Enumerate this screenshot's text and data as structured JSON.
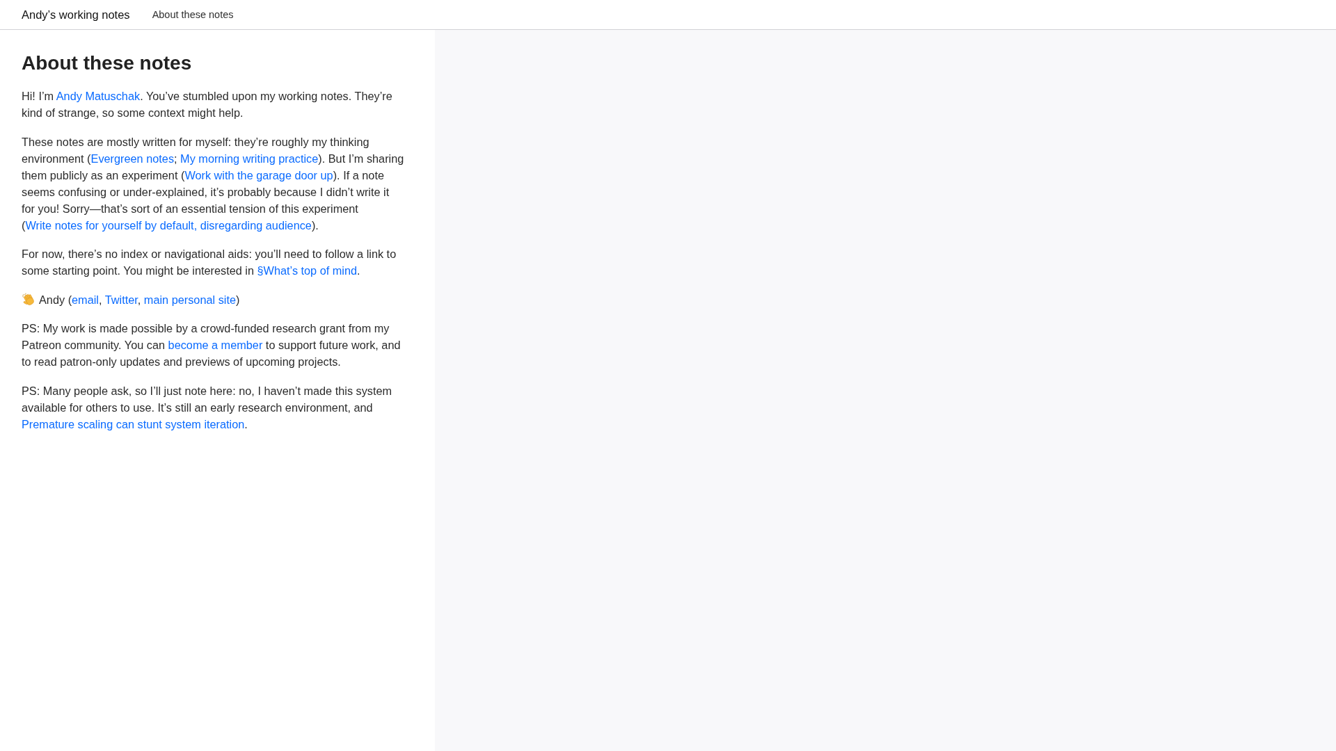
{
  "top_bar": {
    "site_title": "Andy’s working notes",
    "breadcrumbs": [
      {
        "label": "About these notes"
      }
    ]
  },
  "note": {
    "title": "About these notes",
    "paragraphs": [
      {
        "kind": "body",
        "parts": [
          {
            "kind": "text",
            "text": "Hi! I’m "
          },
          {
            "kind": "link",
            "text": "Andy Matuschak"
          },
          {
            "kind": "text",
            "text": ". You’ve stumbled upon my working notes. They’re kind of strange, so some context might help."
          }
        ]
      },
      {
        "kind": "body",
        "parts": [
          {
            "kind": "text",
            "text": "These notes are mostly written for myself: they’re roughly my thinking environment ("
          },
          {
            "kind": "link",
            "text": "Evergreen notes"
          },
          {
            "kind": "text",
            "text": "; "
          },
          {
            "kind": "link",
            "text": "My morning writing practice"
          },
          {
            "kind": "text",
            "text": "). But I’m sharing them publicly as an experiment ("
          },
          {
            "kind": "link",
            "text": "Work with the garage door up"
          },
          {
            "kind": "text",
            "text": "). If a note seems confusing or under-explained, it’s probably because I didn’t write it for you! Sorry—that’s sort of an essential tension of this experiment ("
          },
          {
            "kind": "link",
            "text": "Write notes for yourself by default, disregarding audience"
          },
          {
            "kind": "text",
            "text": ")."
          }
        ]
      },
      {
        "kind": "body",
        "parts": [
          {
            "kind": "text",
            "text": "For now, there’s no index or navigational aids: you’ll need to follow a link to some starting point. You might be interested in "
          },
          {
            "kind": "link",
            "text": "§What’s top of mind"
          },
          {
            "kind": "text",
            "text": "."
          }
        ]
      },
      {
        "kind": "sign_off",
        "parts": [
          {
            "kind": "text",
            "text": "Andy ("
          },
          {
            "kind": "link",
            "text": "email"
          },
          {
            "kind": "text",
            "text": ", "
          },
          {
            "kind": "link",
            "text": "Twitter"
          },
          {
            "kind": "text",
            "text": ", "
          },
          {
            "kind": "link",
            "text": "main personal site"
          },
          {
            "kind": "text",
            "text": ")"
          }
        ]
      },
      {
        "kind": "body",
        "parts": [
          {
            "kind": "text",
            "text": "PS: My work is made possible by a crowd-funded research grant from my Patreon community. You can "
          },
          {
            "kind": "link",
            "text": "become a member"
          },
          {
            "kind": "text",
            "text": " to support future work, and to read patron-only updates and previews of upcoming projects."
          }
        ]
      },
      {
        "kind": "body",
        "parts": [
          {
            "kind": "text",
            "text": "PS: Many people ask, so I’ll just note here: no, I haven’t made this system available for others to use. It’s still an early research environment, and "
          },
          {
            "kind": "link",
            "text": "Premature scaling can stunt system iteration"
          },
          {
            "kind": "text",
            "text": "."
          }
        ]
      }
    ]
  }
}
